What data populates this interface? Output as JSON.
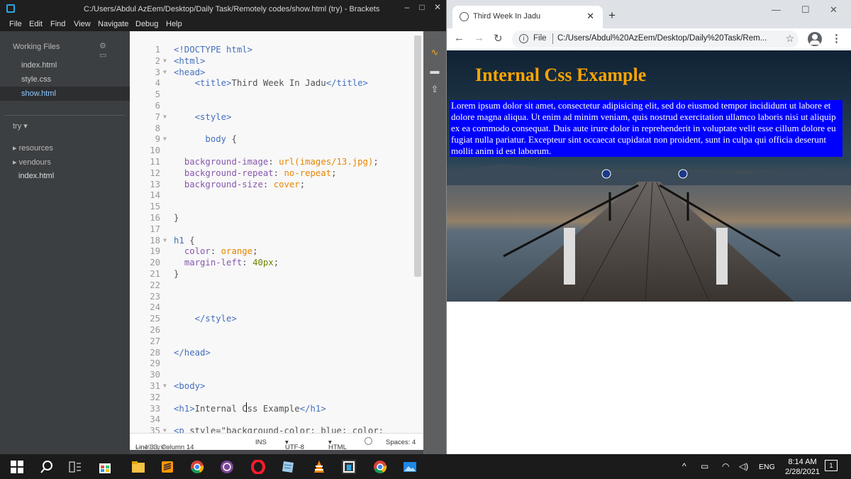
{
  "brackets": {
    "title": "C:/Users/Abdul AzEem/Desktop/Daily Task/Remotely codes/show.html (try) - Brackets",
    "menu": [
      "File",
      "Edit",
      "Find",
      "View",
      "Navigate",
      "Debug",
      "Help"
    ],
    "sidebar": {
      "working_files_label": "Working Files",
      "working_files": [
        "index.html",
        "style.css",
        "show.html"
      ],
      "active_file": "show.html",
      "project_label": "try",
      "tree": [
        "resources",
        "vendours",
        "index.html"
      ]
    },
    "editor_lines": [
      {
        "n": "1",
        "fold": "",
        "code": "<!DOCTYPE html>"
      },
      {
        "n": "2",
        "fold": "▼",
        "code": "<html>"
      },
      {
        "n": "3",
        "fold": "▼",
        "code": "<head>"
      },
      {
        "n": "4",
        "fold": "",
        "code": "    <title>Third Week In Jadu</title>"
      },
      {
        "n": "5",
        "fold": "",
        "code": ""
      },
      {
        "n": "6",
        "fold": "",
        "code": ""
      },
      {
        "n": "7",
        "fold": "▼",
        "code": "    <style>"
      },
      {
        "n": "8",
        "fold": "",
        "code": ""
      },
      {
        "n": "9",
        "fold": "▼",
        "code": "      body {"
      },
      {
        "n": "10",
        "fold": "",
        "code": ""
      },
      {
        "n": "11",
        "fold": "",
        "code": "  background-image: url(images/13.jpg);"
      },
      {
        "n": "12",
        "fold": "",
        "code": "  background-repeat: no-repeat;"
      },
      {
        "n": "13",
        "fold": "",
        "code": "  background-size: cover;"
      },
      {
        "n": "14",
        "fold": "",
        "code": ""
      },
      {
        "n": "15",
        "fold": "",
        "code": ""
      },
      {
        "n": "16",
        "fold": "",
        "code": "}"
      },
      {
        "n": "17",
        "fold": "",
        "code": ""
      },
      {
        "n": "18",
        "fold": "▼",
        "code": "h1 {"
      },
      {
        "n": "19",
        "fold": "",
        "code": "  color: orange;"
      },
      {
        "n": "20",
        "fold": "",
        "code": "  margin-left: 40px;"
      },
      {
        "n": "21",
        "fold": "",
        "code": "}"
      },
      {
        "n": "22",
        "fold": "",
        "code": ""
      },
      {
        "n": "23",
        "fold": "",
        "code": ""
      },
      {
        "n": "24",
        "fold": "",
        "code": ""
      },
      {
        "n": "25",
        "fold": "",
        "code": "    </style>"
      },
      {
        "n": "26",
        "fold": "",
        "code": ""
      },
      {
        "n": "27",
        "fold": "",
        "code": ""
      },
      {
        "n": "28",
        "fold": "",
        "code": "</head>"
      },
      {
        "n": "29",
        "fold": "",
        "code": ""
      },
      {
        "n": "30",
        "fold": "",
        "code": ""
      },
      {
        "n": "31",
        "fold": "▼",
        "code": "<body>"
      },
      {
        "n": "32",
        "fold": "",
        "code": ""
      },
      {
        "n": "33",
        "fold": "",
        "code": "<h1>Internal Css Example</h1>"
      },
      {
        "n": "34",
        "fold": "",
        "code": ""
      },
      {
        "n": "35",
        "fold": "▼",
        "code": "<p style=\"background-color: blue; color:"
      }
    ],
    "status": {
      "position": "Line 33, Column 14",
      "lines": "— 49 Lines",
      "mode": "INS",
      "encoding": "UTF-8",
      "language": "HTML",
      "spaces": "Spaces: 4"
    }
  },
  "chrome": {
    "tab_title": "Third Week In Jadu",
    "address_scheme": "File",
    "address_url": "C:/Users/Abdul%20AzEem/Desktop/Daily%20Task/Rem...",
    "page": {
      "heading": "Internal Css Example",
      "heading_color": "#ffa500",
      "paragraph": "Lorem ipsum dolor sit amet, consectetur adipisicing elit, sed do eiusmod tempor incididunt ut labore et dolore magna aliqua. Ut enim ad minim veniam, quis nostrud exercitation ullamco laboris nisi ut aliquip ex ea commodo consequat. Duis aute irure dolor in reprehenderit in voluptate velit esse cillum dolore eu fugiat nulla pariatur. Excepteur sint occaecat cupidatat non proident, sunt in culpa qui officia deserunt mollit anim id est laborum.",
      "paragraph_bg": "#0000ff"
    }
  },
  "taskbar": {
    "lang": "ENG",
    "time": "8:14 AM",
    "date": "2/28/2021",
    "notification_count": "1"
  }
}
